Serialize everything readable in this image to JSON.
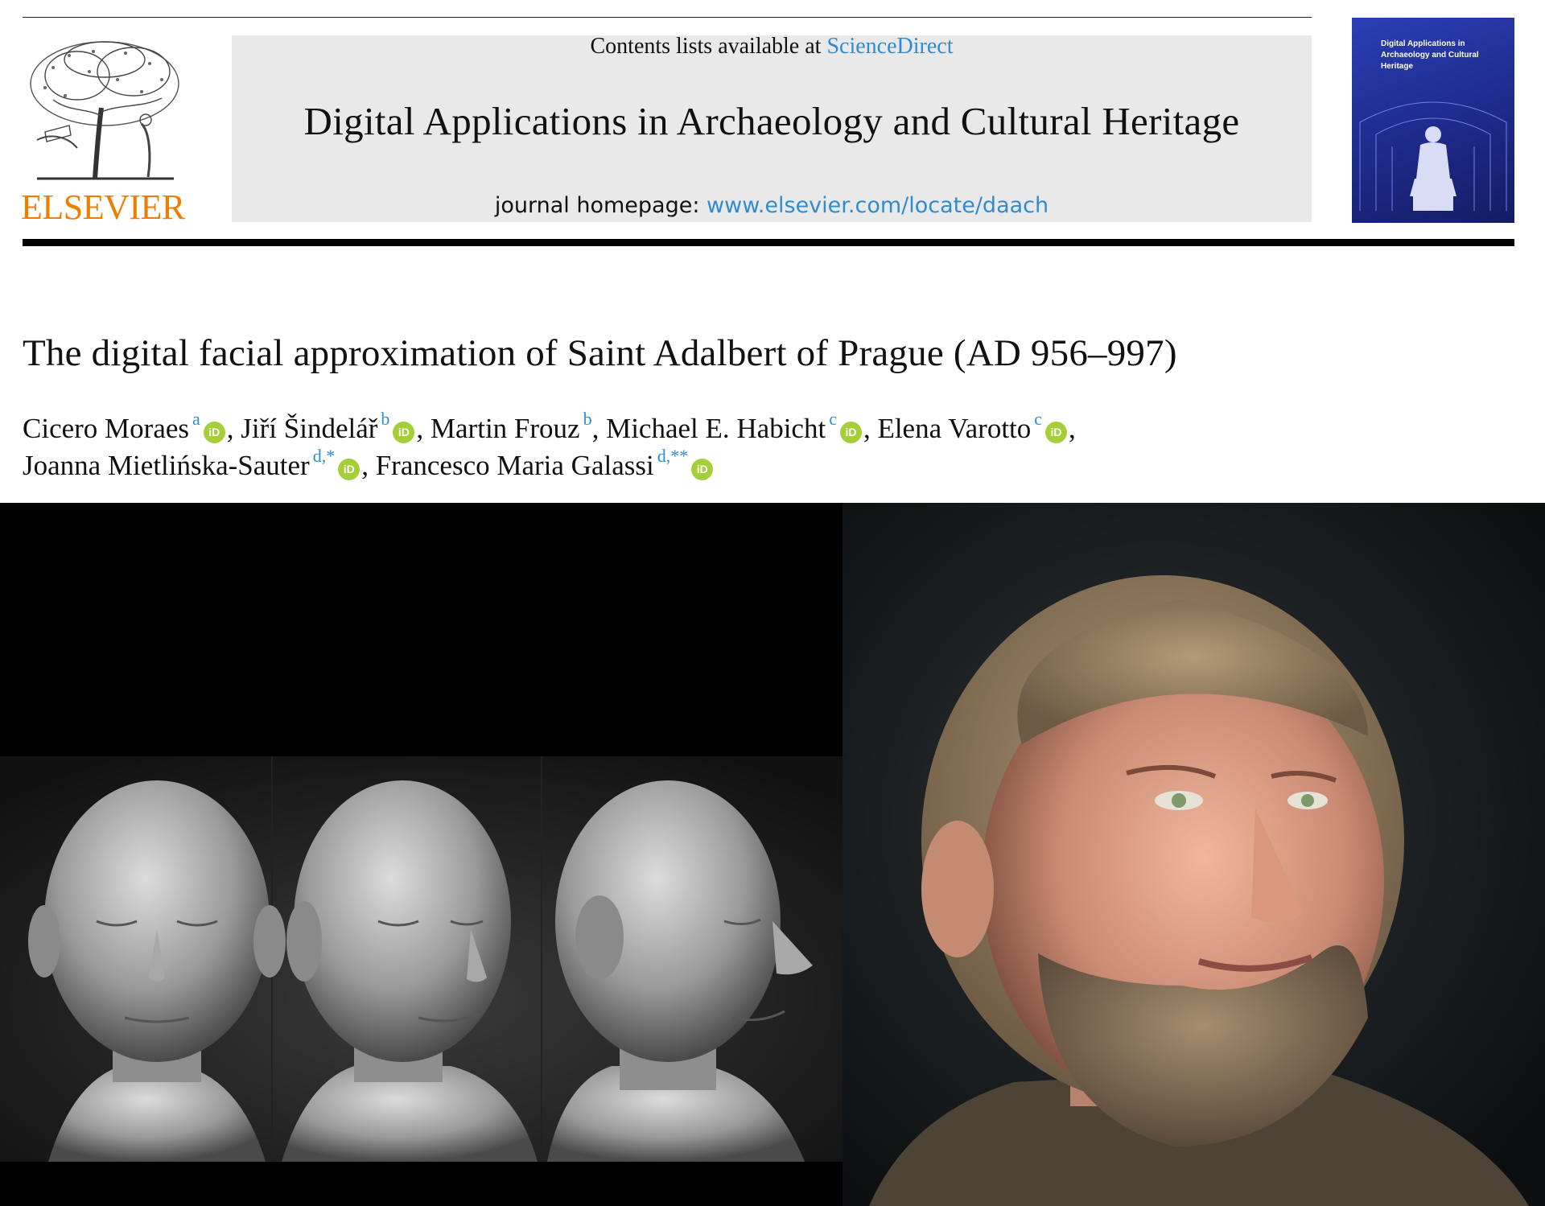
{
  "header": {
    "publisher": "ELSEVIER",
    "contents_prefix": "Contents lists available at ",
    "contents_link": "ScienceDirect",
    "journal_title": "Digital Applications in Archaeology and Cultural Heritage",
    "homepage_prefix": "journal homepage: ",
    "homepage_link": "www.elsevier.com/locate/daach",
    "cover_title": "Digital Applications in Archaeology and Cultural Heritage"
  },
  "article": {
    "title": "The digital facial approximation of Saint Adalbert of Prague (AD 956–997)",
    "authors": [
      {
        "name": "Cicero Moraes",
        "aff": "a",
        "orcid": true
      },
      {
        "name": "Jiří Šindelář",
        "aff": "b",
        "orcid": true
      },
      {
        "name": "Martin Frouz",
        "aff": "b",
        "orcid": false
      },
      {
        "name": "Michael E. Habicht",
        "aff": "c",
        "orcid": true
      },
      {
        "name": "Elena Varotto",
        "aff": "c",
        "orcid": true
      },
      {
        "name": "Joanna Mietlińska-Sauter",
        "aff": "d,*",
        "orcid": true
      },
      {
        "name": "Francesco Maria Galassi",
        "aff": "d,**",
        "orcid": true
      }
    ],
    "orcid_glyph": "iD"
  },
  "icons": {
    "logo": "elsevier-tree-logo-icon",
    "orcid": "orcid-icon"
  },
  "colors": {
    "publisher_orange": "#f07c00",
    "link_blue": "#2e8dd1",
    "orcid_green": "#a6ce39",
    "header_grey": "#e9e9e9"
  }
}
